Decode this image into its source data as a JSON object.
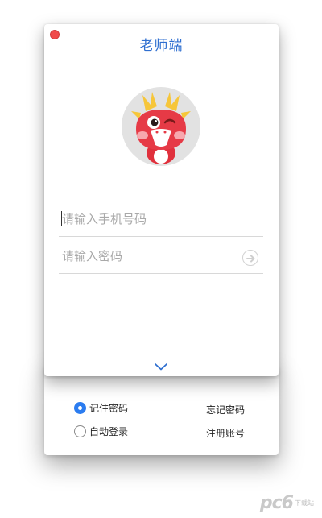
{
  "window": {
    "title": "老师端"
  },
  "login": {
    "phone_placeholder": "请输入手机号码",
    "password_placeholder": "请输入密码"
  },
  "options": {
    "remember_password": {
      "label": "记住密码",
      "checked": true
    },
    "auto_login": {
      "label": "自动登录",
      "checked": false
    },
    "forgot_password": "忘记密码",
    "register_account": "注册账号"
  },
  "watermark": {
    "logo_text": "pc6",
    "sub_text": "下载站"
  },
  "colors": {
    "accent": "#2f6fd0",
    "close": "#f04a4a",
    "radio_checked": "#2b7cf0"
  },
  "icons": [
    "close-icon",
    "dragon-avatar",
    "arrow-right-icon",
    "chevron-down-icon",
    "radio-checked-icon",
    "radio-unchecked-icon"
  ]
}
